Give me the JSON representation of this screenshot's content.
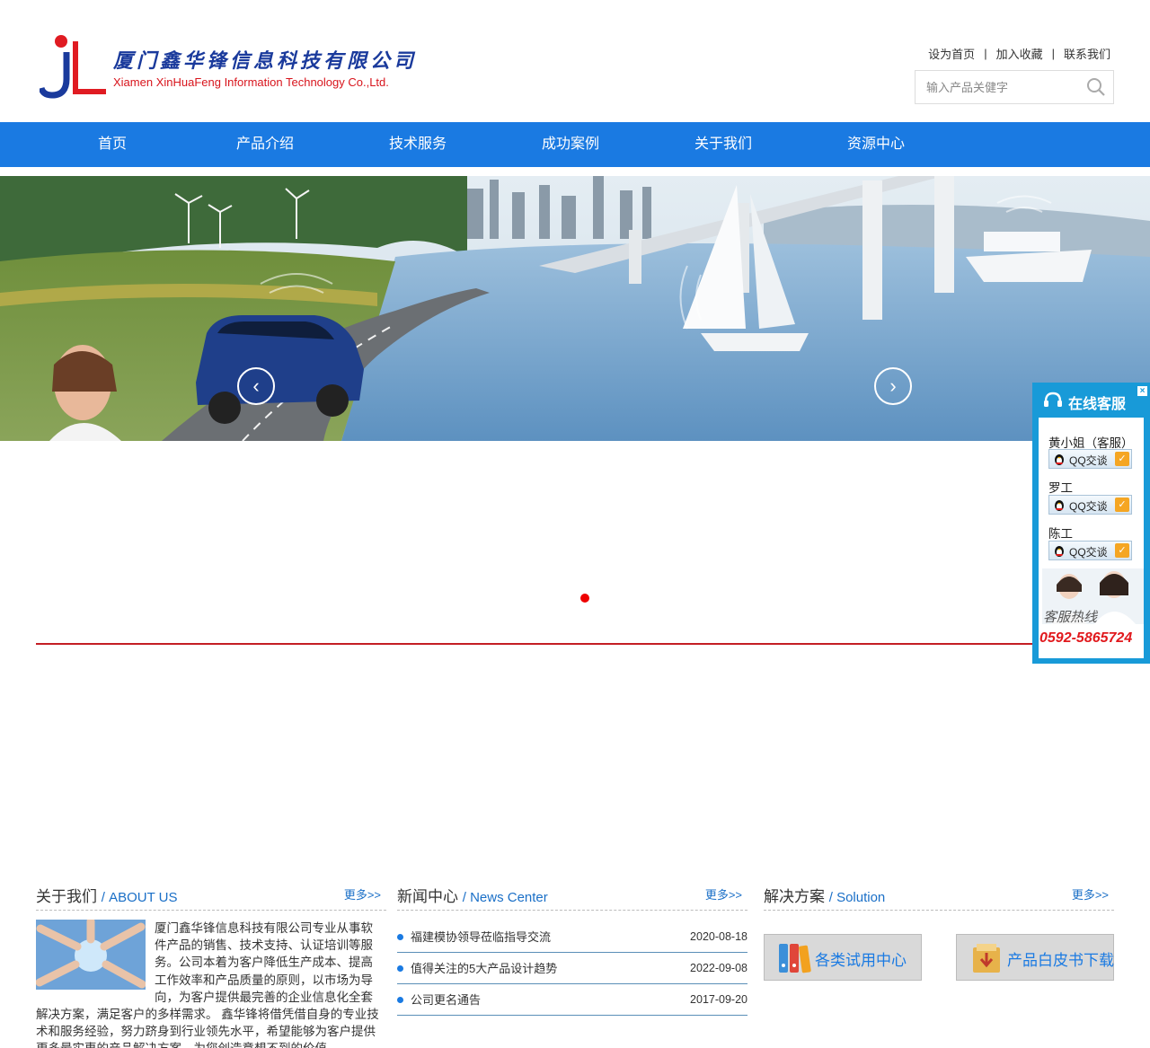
{
  "header": {
    "logo_cn": "厦门鑫华锋信息科技有限公司",
    "logo_en": "Xiamen XinHuaFeng Information Technology Co.,Ltd.",
    "top_links": [
      "设为首页",
      "加入收藏",
      "联系我们"
    ],
    "search_placeholder": "输入产品关健字"
  },
  "nav": {
    "items": [
      "首页",
      "产品介绍",
      "技术服务",
      "成功案例",
      "关于我们",
      "资源中心"
    ]
  },
  "banner": {
    "prev": "‹",
    "next": "›",
    "slide_index": 1,
    "slide_count": 1
  },
  "about": {
    "title": "关于我们",
    "title_en": "/ ABOUT US",
    "more": "更多>>",
    "text": "厦门鑫华锋信息科技有限公司专业从事软件产品的销售、技术支持、认证培训等服务。公司本着为客户降低生产成本、提高工作效率和产品质量的原则，以市场为导向，为客户提供最完善的企业信息化全套解决方案，满足客户的多样需求。 鑫华锋将借凭借自身的专业技术和服务经验，努力跻身到行业领先水平，希望能够为客户提供更多最实惠的产品解决方案，为您创造意想不到的价值"
  },
  "news": {
    "title": "新闻中心",
    "title_en": "/ News Center",
    "more": "更多>>",
    "items": [
      {
        "title": "福建模协领导莅临指导交流",
        "date": "2020-08-18"
      },
      {
        "title": "值得关注的5大产品设计趋势",
        "date": "2022-09-08"
      },
      {
        "title": "公司更名通告",
        "date": "2017-09-20"
      }
    ]
  },
  "solution": {
    "title": "解决方案",
    "title_en": "/ Solution",
    "more": "更多>>",
    "buttons": [
      "各类试用中心",
      "产品白皮书下载"
    ]
  },
  "service": {
    "title": "在线客服",
    "close": "×",
    "people": [
      {
        "name": "黄小姐（客服）",
        "btn": "QQ交谈"
      },
      {
        "name": "罗工",
        "btn": "QQ交谈"
      },
      {
        "name": "陈工",
        "btn": "QQ交谈"
      }
    ],
    "hotline_label": "客服热线",
    "hotline": "0592-5865724"
  },
  "colors": {
    "nav": "#1a7ae2",
    "accent_red": "#c41e24",
    "service": "#189ad8"
  }
}
